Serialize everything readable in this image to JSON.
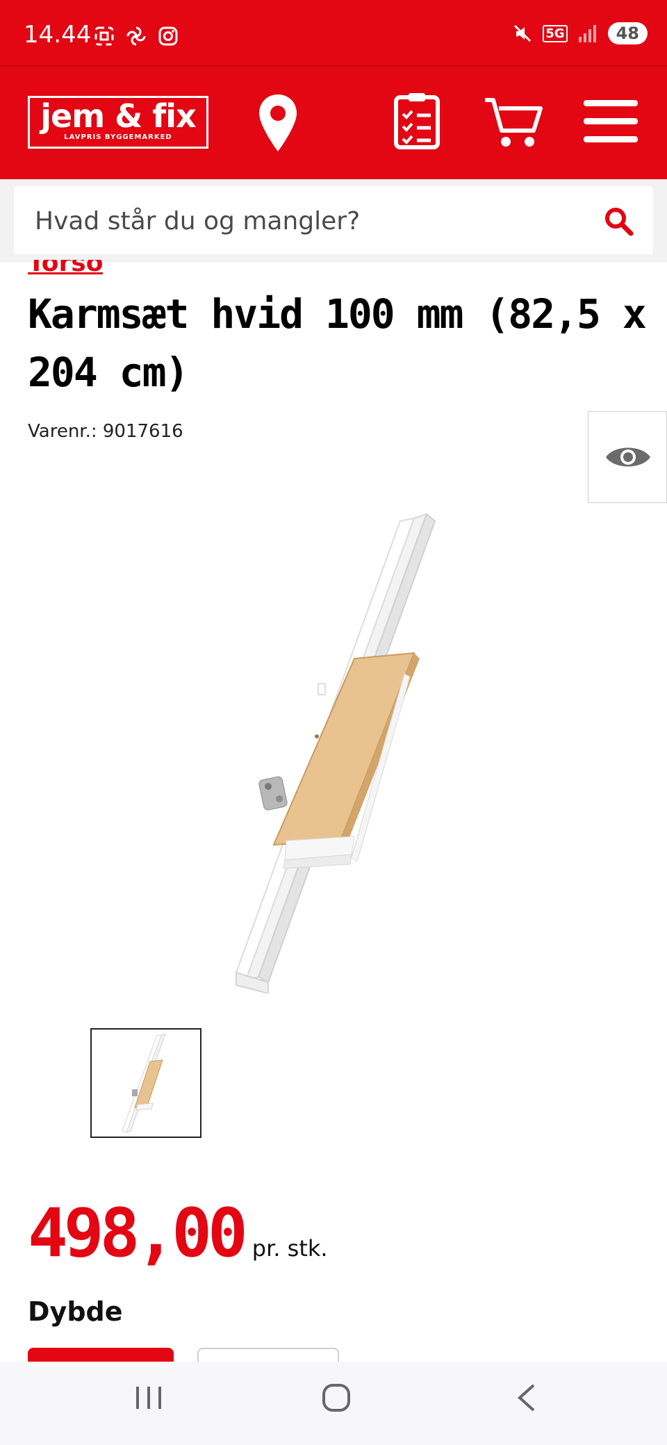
{
  "status_bar": {
    "time": "14.44",
    "battery": "48",
    "signal": "5G"
  },
  "header": {
    "logo_main": "jem & fix",
    "logo_sub": "LAVPRIS BYGGEMARKED",
    "icons": [
      "location-pin-icon",
      "checklist-icon",
      "cart-icon",
      "menu-icon"
    ]
  },
  "search": {
    "placeholder": "Hvad står du og mangler?"
  },
  "product": {
    "brand": "Torso",
    "title": "Karmsæt hvid 100 mm (82,5 x 204 cm)",
    "sku": "Varenr.: 9017616",
    "price": "498,00",
    "unit": "pr. stk.",
    "dimension_label": "Dybde"
  },
  "colors": {
    "brand_red": "#e30613",
    "white": "#ffffff"
  }
}
